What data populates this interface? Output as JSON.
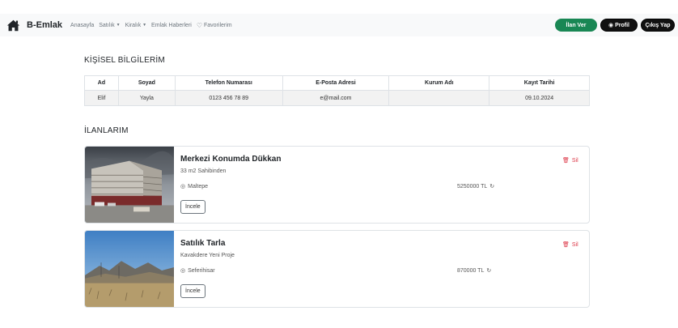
{
  "navbar": {
    "brand": "B-Emlak",
    "links": [
      "Anasayfa",
      "Satılık",
      "Kiralık",
      "Emlak Haberleri",
      "Favorilerim"
    ],
    "ilan_ver": "İlan Ver",
    "profil": "Profil",
    "cikis": "Çıkış Yap",
    "colors": {
      "green": "#198754",
      "dark": "#111111"
    }
  },
  "personal": {
    "title": "KİŞİSEL BİLGİLERİM",
    "headers": [
      "Ad",
      "Soyad",
      "Telefon Numarası",
      "E-Posta Adresi",
      "Kurum Adı",
      "Kayıt Tarihi"
    ],
    "row": [
      "Elif",
      "Yayla",
      "0123 456 78 89",
      "e@mail.com",
      "",
      "09.10.2024"
    ]
  },
  "listings": {
    "title": "İLANLARIM",
    "items": [
      {
        "title": "Merkezi Konumda Dükkan",
        "subtitle": "33 m2 Sahibinden",
        "location": "Maltepe",
        "price": "5250000 TL",
        "button": "İncele",
        "delete": "Sil",
        "image": "city-building-photo"
      },
      {
        "title": "Satılık Tarla",
        "subtitle": "Kavakdere Yeni Proje",
        "location": "Seferihisar",
        "price": "870000 TL",
        "button": "İncele",
        "delete": "Sil",
        "image": "field-landscape-photo"
      }
    ]
  }
}
